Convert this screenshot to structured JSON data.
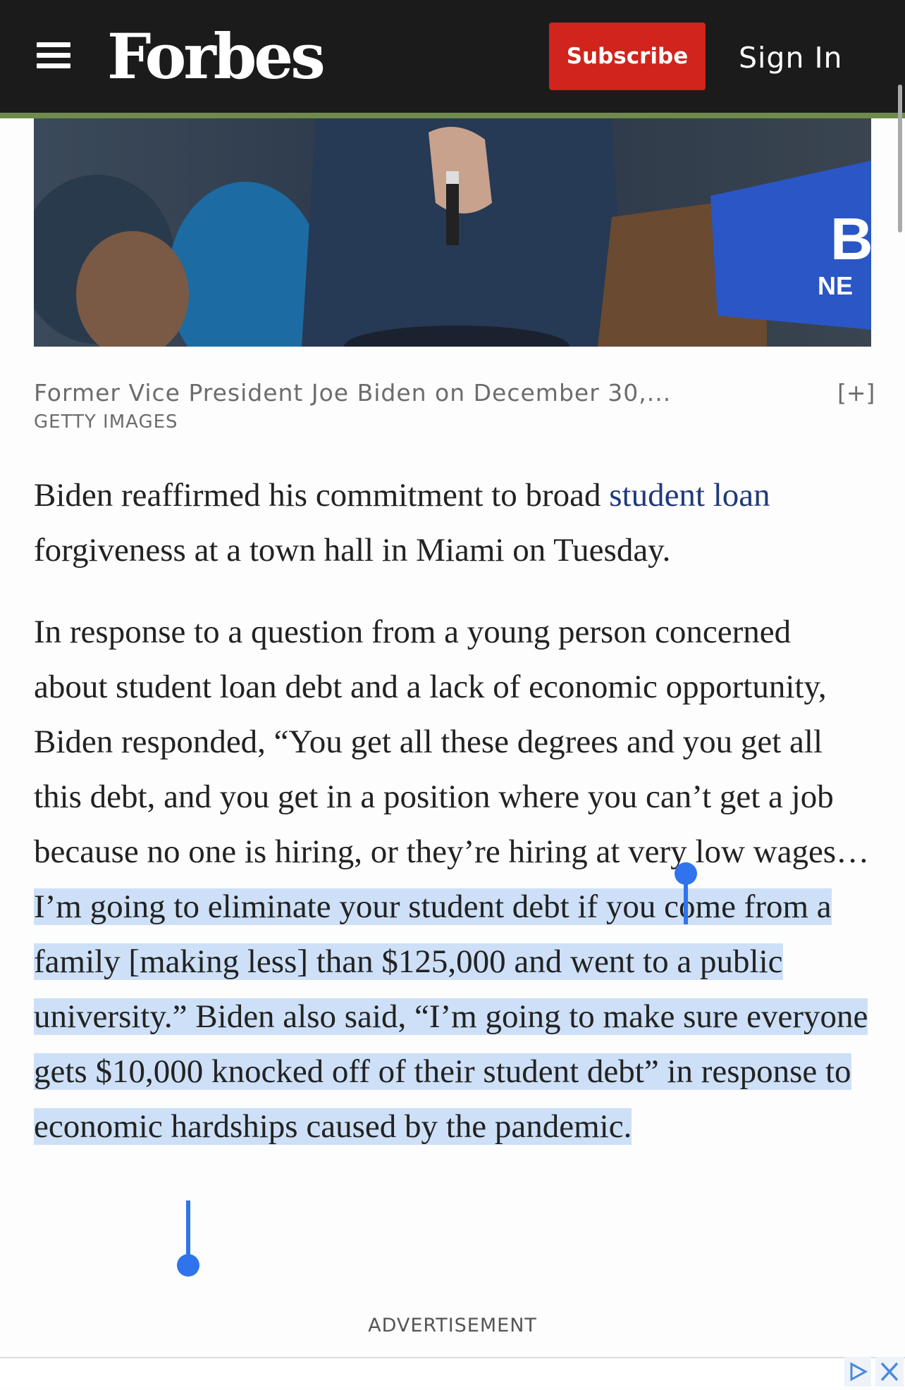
{
  "header": {
    "logo": "Forbes",
    "subscribe_label": "Subscribe",
    "signin_label": "Sign In"
  },
  "image": {
    "caption": "Former Vice President Joe Biden on December 30,...",
    "expand_label": "[+]",
    "credit": "GETTY IMAGES"
  },
  "article": {
    "p1_before": "Biden reaffirmed his commitment to broad ",
    "p1_link": "student loan",
    "p1_after": " forgiveness at a town hall in Miami on Tuesday.",
    "p2_unselected": "In response to a question from a young person concerned about student loan debt and a lack of economic opportunity, Biden responded, “You get all these degrees and you get all this debt, and you get in a position where you can’t get a job because no one is hiring, or they’re hiring at very low wages… ",
    "p2_selected": "I’m going to eliminate your student debt if you come from a family [making less] than $125,000 and went to a public university.” Biden also said, “I’m going to make sure everyone gets $10,000 knocked off of their student debt” in response to economic hardships caused by the pandemic."
  },
  "ad": {
    "label": "ADVERTISEMENT"
  },
  "colors": {
    "header_bg": "#1b1b1b",
    "accent_stripe": "#6f8a4d",
    "subscribe_bg": "#d0241c",
    "link": "#1f3a7a",
    "selection": "#cde0f7",
    "selection_handle": "#2f74ec"
  },
  "icons": {
    "menu": "menu-icon",
    "adchoices": "adchoices-icon",
    "close": "close-icon"
  }
}
